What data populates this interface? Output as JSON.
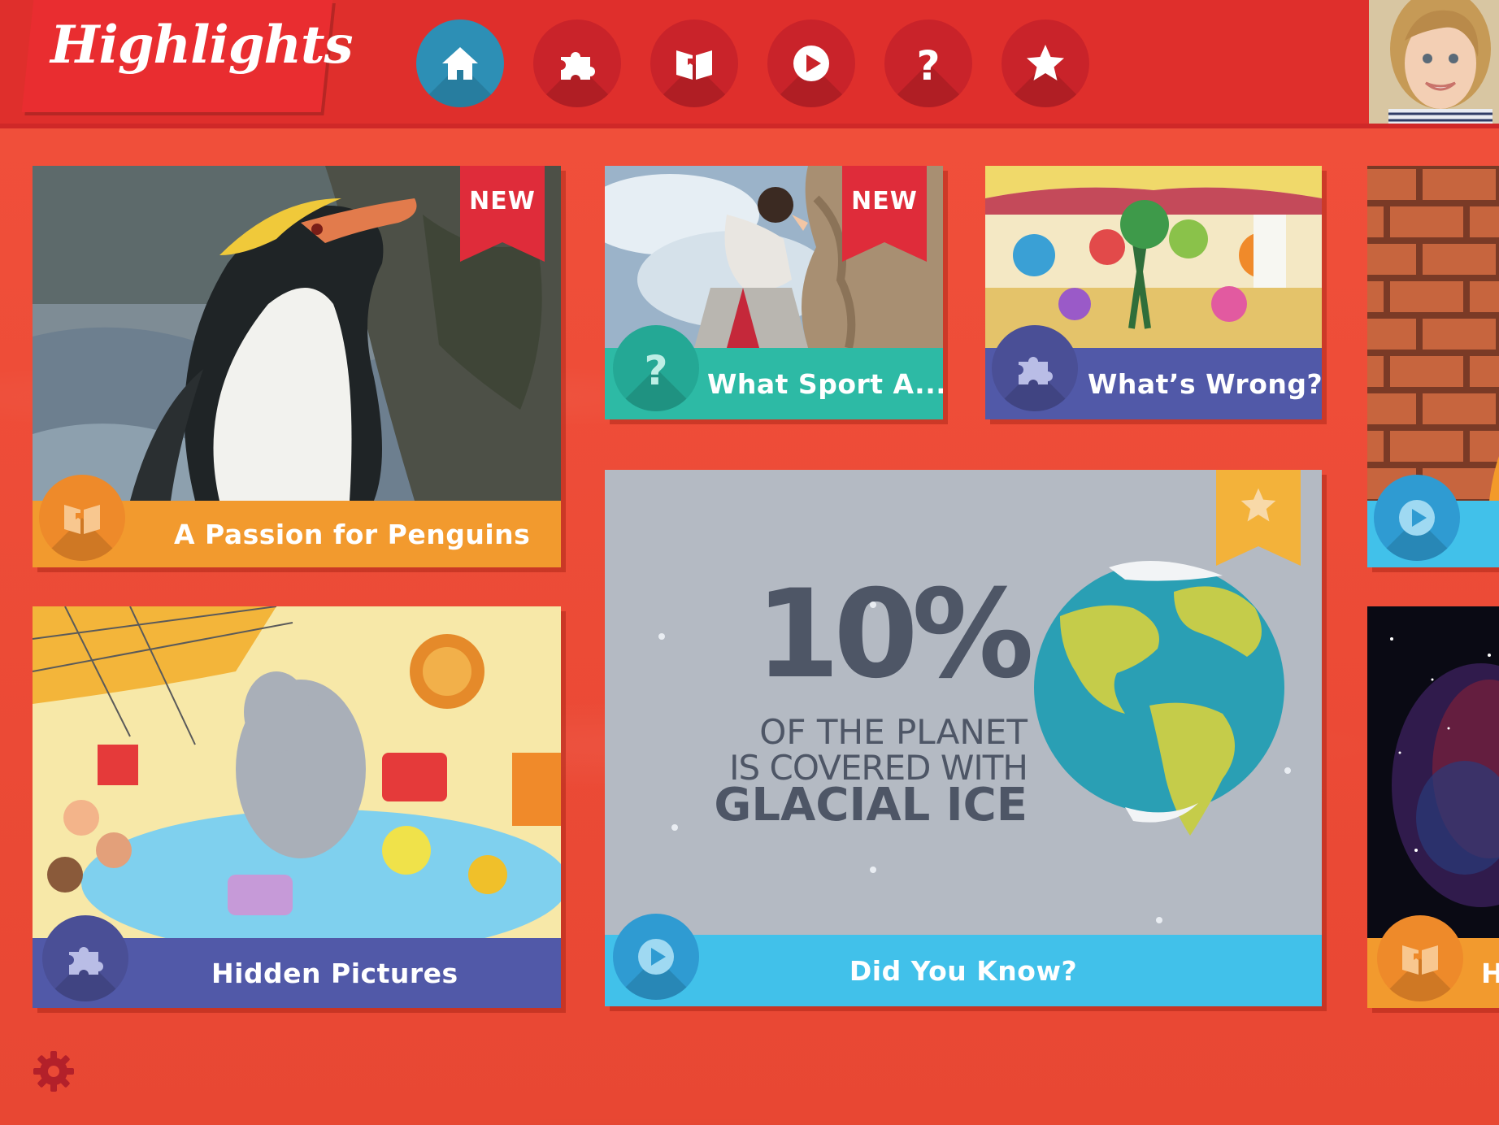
{
  "app": {
    "logo": "Highlights"
  },
  "nav": [
    {
      "icon": "home-icon",
      "active": true
    },
    {
      "icon": "puzzle-icon",
      "active": false
    },
    {
      "icon": "book-icon",
      "active": false
    },
    {
      "icon": "play-icon",
      "active": false
    },
    {
      "icon": "question-icon",
      "active": false
    },
    {
      "icon": "star-icon",
      "active": false
    }
  ],
  "cards": {
    "penguins": {
      "title": "A Passion for Penguins",
      "badge": "NEW",
      "type_icon": "book-icon",
      "bar_color": "#f29a2e"
    },
    "sport": {
      "title": "What Sport A...",
      "badge": "NEW",
      "type_icon": "question-icon",
      "bar_color": "#2dbaa5"
    },
    "wrong": {
      "title": "What’s Wrong?",
      "type_icon": "puzzle-icon",
      "bar_color": "#5159a8"
    },
    "hidden": {
      "title": "Hidden Pictures",
      "type_icon": "puzzle-icon",
      "bar_color": "#5159a8"
    },
    "didyouknow": {
      "title": "Did You Know?",
      "type_icon": "play-icon",
      "badge_icon": "star-icon",
      "bar_color": "#41c1ea",
      "fact_big": "10%",
      "fact_line1": "OF THE PLANET",
      "fact_line2": "IS COVERED WITH",
      "fact_line3": "GLACIAL ICE"
    },
    "partial_top": {
      "type_icon": "play-icon",
      "bar_color": "#41c1ea"
    },
    "partial_bottom": {
      "title": "H",
      "type_icon": "book-icon",
      "bar_color": "#f29a2e"
    }
  },
  "settings": {
    "icon": "gear-icon"
  }
}
